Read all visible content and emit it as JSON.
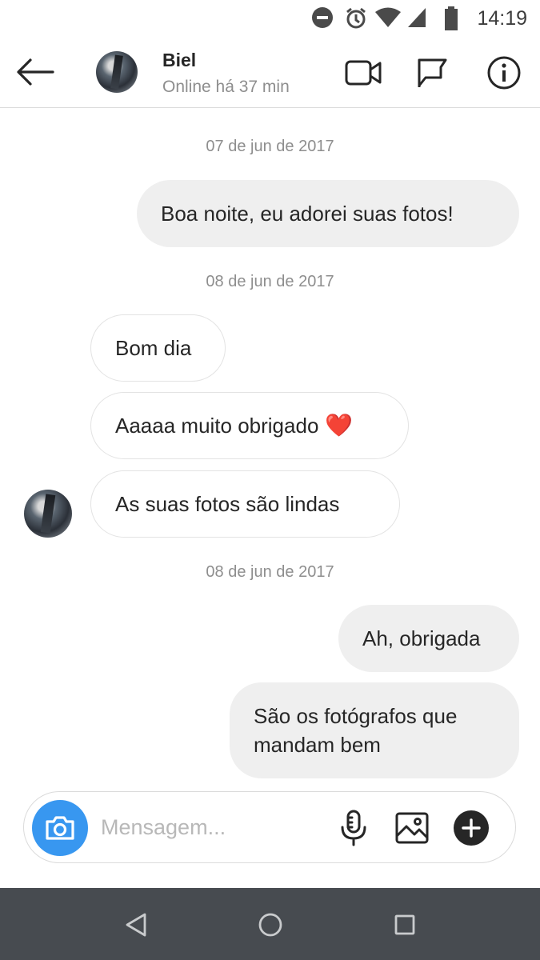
{
  "status_bar": {
    "time": "14:19",
    "icons": [
      "do-not-disturb-icon",
      "alarm-icon",
      "wifi-icon",
      "cellular-signal-icon",
      "battery-icon"
    ]
  },
  "header": {
    "back_icon": "arrow-left-icon",
    "contact_name": "Biel",
    "contact_status": "Online há 37 min",
    "actions": [
      "video-call-icon",
      "flag-icon",
      "info-icon"
    ]
  },
  "messages": {
    "dates": [
      "07 de jun de 2017",
      "08 de jun de 2017",
      "08 de jun de 2017"
    ],
    "items": [
      {
        "dir": "out",
        "text": "Boa noite, eu adorei suas fotos!"
      },
      {
        "dir": "in",
        "text": "Bom dia"
      },
      {
        "dir": "in",
        "text": "Aaaaa muito obrigado",
        "emoji": "❤️"
      },
      {
        "dir": "in",
        "text": "As suas fotos são lindas"
      },
      {
        "dir": "out",
        "text": "Ah, obrigada"
      },
      {
        "dir": "out",
        "text": "São os fotógrafos que mandam bem"
      }
    ]
  },
  "composer": {
    "placeholder": "Mensagem...",
    "camera_icon": "camera-icon",
    "icons": [
      "microphone-icon",
      "gallery-icon",
      "plus-icon"
    ]
  },
  "nav_bar": {
    "icons": [
      "back-triangle-icon",
      "home-circle-icon",
      "recents-square-icon"
    ]
  },
  "colors": {
    "accent": "#3897f0",
    "outgoing_bubble": "#efefef",
    "nav_bar": "#474b50",
    "muted_text": "#8e8e8e",
    "heart": "#e0202e"
  }
}
